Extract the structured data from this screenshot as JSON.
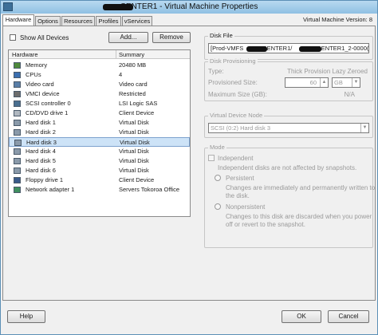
{
  "window": {
    "title": "CENTER1 - Virtual Machine Properties",
    "version_label": "Virtual Machine Version: 8"
  },
  "tabs": [
    {
      "label": "Hardware",
      "active": true
    },
    {
      "label": "Options",
      "active": false
    },
    {
      "label": "Resources",
      "active": false
    },
    {
      "label": "Profiles",
      "active": false
    },
    {
      "label": "vServices",
      "active": false
    }
  ],
  "hardware": {
    "show_all_label": "Show All Devices",
    "add_label": "Add...",
    "remove_label": "Remove",
    "columns": {
      "hardware": "Hardware",
      "summary": "Summary"
    },
    "selected_row": "Hard disk 3",
    "rows": [
      {
        "icon": "memory-icon",
        "name": "Memory",
        "summary": "20480 MB"
      },
      {
        "icon": "cpu-icon",
        "name": "CPUs",
        "summary": "4"
      },
      {
        "icon": "video-card-icon",
        "name": "Video card",
        "summary": "Video card"
      },
      {
        "icon": "vmci-icon",
        "name": "VMCI device",
        "summary": "Restricted"
      },
      {
        "icon": "scsi-controller-icon",
        "name": "SCSI controller 0",
        "summary": "LSI Logic SAS"
      },
      {
        "icon": "cd-dvd-icon",
        "name": "CD/DVD drive 1",
        "summary": "Client Device"
      },
      {
        "icon": "hard-disk-icon",
        "name": "Hard disk 1",
        "summary": "Virtual Disk"
      },
      {
        "icon": "hard-disk-icon",
        "name": "Hard disk 2",
        "summary": "Virtual Disk"
      },
      {
        "icon": "hard-disk-icon",
        "name": "Hard disk 3",
        "summary": "Virtual Disk"
      },
      {
        "icon": "hard-disk-icon",
        "name": "Hard disk 4",
        "summary": "Virtual Disk"
      },
      {
        "icon": "hard-disk-icon",
        "name": "Hard disk 5",
        "summary": "Virtual Disk"
      },
      {
        "icon": "hard-disk-icon",
        "name": "Hard disk 6",
        "summary": "Virtual Disk"
      },
      {
        "icon": "floppy-icon",
        "name": "Floppy drive 1",
        "summary": "Client Device"
      },
      {
        "icon": "network-adapter-icon",
        "name": "Network adapter 1",
        "summary": "Servers Tokoroa Office"
      }
    ]
  },
  "disk_file": {
    "title": "Disk File",
    "value_start": "[Prod-VMFS",
    "value_mid": "CENTER1/",
    "value_end": "VCENTER1_2-0000("
  },
  "disk_provisioning": {
    "title": "Disk Provisioning",
    "type_label": "Type:",
    "type_value": "Thick Provision Lazy Zeroed",
    "size_label": "Provisioned Size:",
    "size_value": "60",
    "size_unit": "GB",
    "max_label": "Maximum Size (GB):",
    "max_value": "N/A"
  },
  "virtual_device_node": {
    "title": "Virtual Device Node",
    "value": "SCSI (0:2) Hard disk 3"
  },
  "mode": {
    "title": "Mode",
    "independent_label": "Independent",
    "independent_desc": "Independent disks are not affected by snapshots.",
    "persistent_label": "Persistent",
    "persistent_desc_1": "Changes are immediately and permanently written to",
    "persistent_desc_2": "the disk.",
    "nonpersistent_label": "Nonpersistent",
    "nonpersistent_desc_1": "Changes to this disk are discarded when you power",
    "nonpersistent_desc_2": "off or revert to the snapshot."
  },
  "footer": {
    "help_label": "Help",
    "ok_label": "OK",
    "cancel_label": "Cancel"
  },
  "colors": {
    "selection": "#cde3f7",
    "titlebar": "#8fc0e3",
    "dialog_bg": "#f0f0f0"
  }
}
